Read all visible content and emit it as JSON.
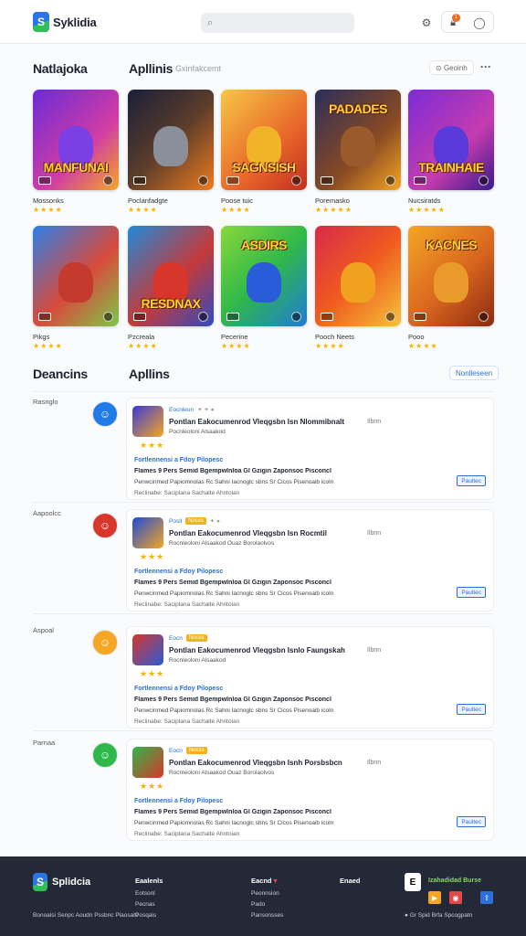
{
  "header": {
    "brand": "Syklidia",
    "search_placeholder": "",
    "icons": [
      "settings-icon",
      "notification-icon",
      "profile-icon"
    ],
    "notification_count": "1"
  },
  "featured": {
    "left_title": "Natlajoka",
    "title": "Apllinis",
    "subtitle": "Gxinfakcemt",
    "filter_label": "Geoinh",
    "games": [
      {
        "name": "Mossonks",
        "art_title": "MANFUNAI",
        "stars": "★★★★",
        "bg": "linear-gradient(135deg,#6a2bd8,#d13ca5 60%,#f5a623)",
        "hero": "#7b3fe4"
      },
      {
        "name": "Poclanfadgte",
        "art_title": "",
        "stars": "★★★★",
        "bg": "linear-gradient(135deg,#1a1f3a,#5a3c2a 50%,#f07b1f)",
        "hero": "#8a8f99"
      },
      {
        "name": "Poose tuic",
        "art_title": "SAGNSISH",
        "stars": "★★★★",
        "bg": "linear-gradient(135deg,#f6c744,#e8672a 60%,#c32f1f)",
        "hero": "#f0b32a"
      },
      {
        "name": "Poremasko",
        "art_title": "PADADES",
        "stars": "★★★★★",
        "bg": "linear-gradient(135deg,#2b2f5a,#8a4a22 60%,#f5a623)",
        "hero": "#9b5a2c"
      },
      {
        "name": "Nucsiratds",
        "art_title": "TRAINHAIE",
        "stars": "★★★★★",
        "bg": "linear-gradient(135deg,#7b2bd8,#c53caf 60%,#3a1a8a)",
        "hero": "#5a3ad8"
      },
      {
        "name": "Pikgs",
        "art_title": "",
        "stars": "★★★★",
        "bg": "linear-gradient(135deg,#2b7fe8,#d84a3c 55%,#7ec84a)",
        "hero": "#c43a2c"
      },
      {
        "name": "Pzcreala",
        "art_title": "RESDNAX",
        "stars": "★★★★",
        "bg": "linear-gradient(135deg,#1f8ad8,#c43a3a 55%,#2f4bbf)",
        "hero": "#d8362a"
      },
      {
        "name": "Pecerine",
        "art_title": "ASDIRS",
        "stars": "★★★★",
        "bg": "linear-gradient(135deg,#8ad83a,#2fb84a 50%,#1f7bd8)",
        "hero": "#2a5bd8"
      },
      {
        "name": "Pooch Neets",
        "art_title": "",
        "stars": "★★★★",
        "bg": "linear-gradient(135deg,#d82a4a,#f05a1f 50%,#f5c23a)",
        "hero": "#f2a01f"
      },
      {
        "name": "Pooo",
        "art_title": "KACNES",
        "stars": "★★★★",
        "bg": "linear-gradient(135deg,#f5a623,#d8651f 55%,#8a2a0f)",
        "hero": "#e89a2a"
      }
    ]
  },
  "reviews": {
    "left_title": "Deancins",
    "title": "Apllins",
    "action_label": "Nonlleseen",
    "items": [
      {
        "label": "Rasnglo",
        "avatar_bg": "#1f7be8",
        "thumb_bg": "linear-gradient(135deg,#3a3ad8,#f5a623)",
        "meta_name": "Eocnleun",
        "meta_tag": "",
        "meta_extra": "✦ ✦ ●",
        "headline": "Pontlan Eakocumenrod Vleqgsbn Isn Nlommibnalt",
        "sub": "Pocnleoloni Alsaakod",
        "stars": "★★★",
        "right": "Ilbnn",
        "subhead": "Fortlennensi a Fdoy Pilopesc",
        "line1": "Flames 9 Pers Semid Bgempwlnloa Gl Gzigin Zaponsoc Pisconcl",
        "line2": "Penwcinmed Papiomnolas Rc Sahni Iacnoglc sbns Sr Cicos Pisenoaib icoln",
        "line3": "Reclinabe: Saciplana Sachalte Ahntoian",
        "button": "Paultec"
      },
      {
        "label": "Aapoolcc",
        "avatar_bg": "#d8362a",
        "thumb_bg": "linear-gradient(135deg,#1f4bd8,#f5a623)",
        "meta_name": "Posll",
        "meta_tag": "Nocss",
        "meta_extra": "✦ ●",
        "headline": "Pontlan Eakocumenrod Vleqgsbn Isn Rocmtil",
        "sub": "Rocnleoloni Alsaakod Ouaz Borolaolvos",
        "stars": "★★★",
        "right": "Ilbnn",
        "subhead": "Fortlennensi a Fdoy Pilopesc",
        "line1": "Flames 9 Pers Semid Bgempwlnloa Gl Gzigin Zaponsoc Pisconcl",
        "line2": "Penwcinmed Papiomnolas Rc Sahni Iacnoglc sbns Sr Cicos Pisenoaib icoln",
        "line3": "Reclinabe: Saciplana Sachalte Ahntoian",
        "button": "Paultec"
      },
      {
        "label": "Aspoal",
        "avatar_bg": "#f5a623",
        "thumb_bg": "linear-gradient(135deg,#d8362a,#2a5bd8)",
        "meta_name": "Eocn",
        "meta_tag": "Nocss",
        "meta_extra": "",
        "headline": "Pontlan Eakocumenrod Vleqgsbn Isnlo Faungskah",
        "sub": "Rocnleoloni Alsaakod",
        "stars": "★★★",
        "right": "Ilbnn",
        "subhead": "Fortlennensi a Fdoy Pilopesc",
        "line1": "Flames 9 Pers Semid Bgempwlnloa Gl Gzigin Zaponsoc Pisconcl",
        "line2": "Penwcinmed Papiomnolas Rc Sahni Iacnoglc sbns Sr Cicos Pisenoaib icoln",
        "line3": "Reclinabe: Saciplana Sachalte Ahntoian",
        "button": "Paultec"
      },
      {
        "label": "Parnaa",
        "avatar_bg": "#2fb84a",
        "thumb_bg": "linear-gradient(135deg,#2fb84a,#d8362a)",
        "meta_name": "Eocn",
        "meta_tag": "Nocss",
        "meta_extra": "",
        "headline": "Pontlan Eakocumenrod Vleqgsbn Isnh Porsbsbcn",
        "sub": "Rocnleoloni Alsaakod Ouaz Borolaolvos",
        "stars": "★★★",
        "right": "Ilbnn",
        "subhead": "Fortlennensi a Fdoy Pilopesc",
        "line1": "Flames 9 Pers Semid Bgempwlnloa Gl Gzigin Zaponsoc Pisconcl",
        "line2": "Penwcinmed Papiomnolas Rc Sahni Iacnoglc sbns Sr Cicos Pisenoaib icoln",
        "line3": "Reclinabe: Saciplana Sachalte Ahntoian",
        "button": "Paultec"
      }
    ]
  },
  "footer": {
    "brand": "Splidcia",
    "copyright": "Bonoalsi Senpc Aoudn Pssbnc Plaosats",
    "columns": [
      {
        "heading": "Eaalenls",
        "items": [
          "Eotsonl",
          "Pecnas",
          "Posqais"
        ]
      },
      {
        "heading": "Eacnd",
        "items": [
          "Peonnsion",
          "Pado",
          "Pansonsses"
        ]
      },
      {
        "heading": "Enaed",
        "items": []
      }
    ],
    "store_letter": "E",
    "store_heading": "Izahadidad Burse",
    "store_icons": [
      "play-icon",
      "game-icon",
      "share-icon"
    ],
    "bottom_text": "● Gr Spid Brfa Spcogpatn"
  }
}
